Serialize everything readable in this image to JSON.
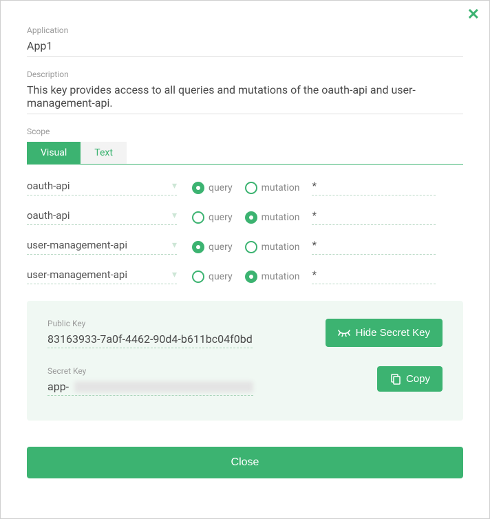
{
  "close_icon": "✕",
  "fields": {
    "application_label": "Application",
    "application_value": "App1",
    "description_label": "Description",
    "description_value": "This key provides access to all queries and mutations of the oauth-api and user-management-api.",
    "scope_label": "Scope"
  },
  "tabs": {
    "visual": "Visual",
    "text": "Text",
    "active": "visual"
  },
  "scope_rows": [
    {
      "api": "oauth-api",
      "checked": "query",
      "query": "query",
      "mutation": "mutation",
      "pattern": "*"
    },
    {
      "api": "oauth-api",
      "checked": "mutation",
      "query": "query",
      "mutation": "mutation",
      "pattern": "*"
    },
    {
      "api": "user-management-api",
      "checked": "query",
      "query": "query",
      "mutation": "mutation",
      "pattern": "*"
    },
    {
      "api": "user-management-api",
      "checked": "mutation",
      "query": "query",
      "mutation": "mutation",
      "pattern": "*"
    }
  ],
  "keys": {
    "public_label": "Public Key",
    "public_value": "83163933-7a0f-4462-90d4-b611bc04f0bd",
    "secret_label": "Secret Key",
    "secret_prefix": "app-",
    "hide_button": "Hide Secret Key",
    "copy_button": "Copy"
  },
  "close_button": "Close",
  "colors": {
    "primary": "#3cb371"
  }
}
